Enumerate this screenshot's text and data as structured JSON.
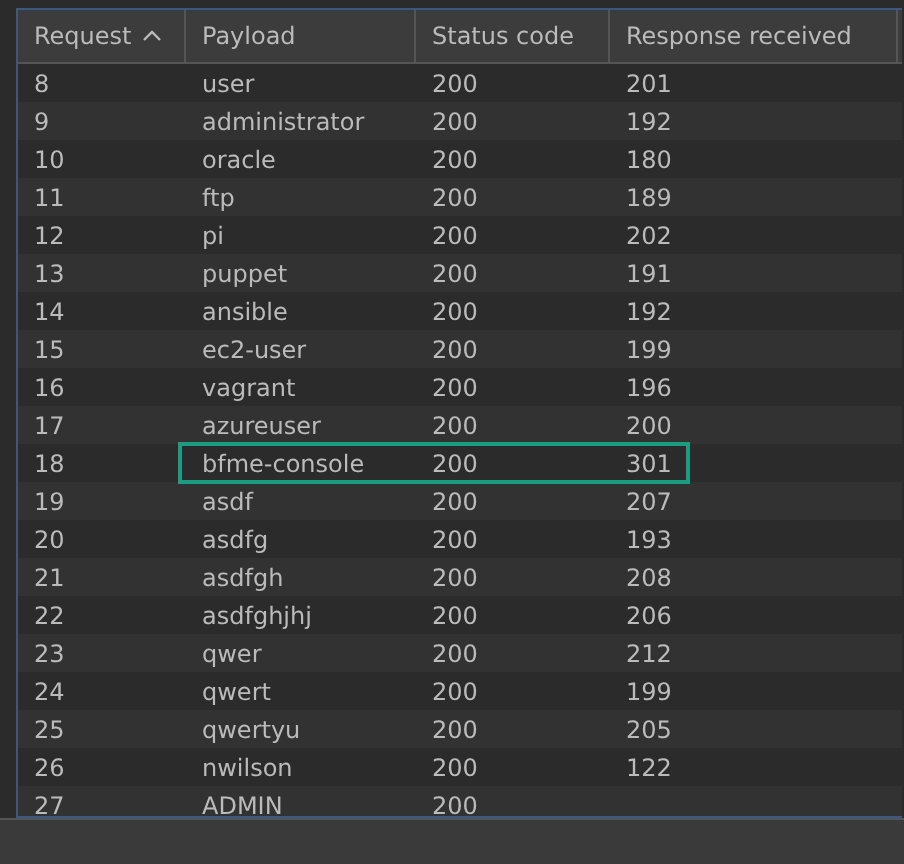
{
  "table": {
    "columns": [
      {
        "label": "Request",
        "sorted": true
      },
      {
        "label": "Payload"
      },
      {
        "label": "Status code"
      },
      {
        "label": "Response received"
      }
    ],
    "rows": [
      {
        "cells": [
          "8",
          "user",
          "200",
          "201"
        ],
        "highlighted": false
      },
      {
        "cells": [
          "9",
          "administrator",
          "200",
          "192"
        ],
        "highlighted": false
      },
      {
        "cells": [
          "10",
          "oracle",
          "200",
          "180"
        ],
        "highlighted": false
      },
      {
        "cells": [
          "11",
          "ftp",
          "200",
          "189"
        ],
        "highlighted": false
      },
      {
        "cells": [
          "12",
          "pi",
          "200",
          "202"
        ],
        "highlighted": false
      },
      {
        "cells": [
          "13",
          "puppet",
          "200",
          "191"
        ],
        "highlighted": false
      },
      {
        "cells": [
          "14",
          "ansible",
          "200",
          "192"
        ],
        "highlighted": false
      },
      {
        "cells": [
          "15",
          "ec2-user",
          "200",
          "199"
        ],
        "highlighted": false
      },
      {
        "cells": [
          "16",
          "vagrant",
          "200",
          "196"
        ],
        "highlighted": false
      },
      {
        "cells": [
          "17",
          "azureuser",
          "200",
          "200"
        ],
        "highlighted": false
      },
      {
        "cells": [
          "18",
          "bfme-console",
          "200",
          "301"
        ],
        "highlighted": true
      },
      {
        "cells": [
          "19",
          "asdf",
          "200",
          "207"
        ],
        "highlighted": false
      },
      {
        "cells": [
          "20",
          "asdfg",
          "200",
          "193"
        ],
        "highlighted": false
      },
      {
        "cells": [
          "21",
          "asdfgh",
          "200",
          "208"
        ],
        "highlighted": false
      },
      {
        "cells": [
          "22",
          "asdfghjhj",
          "200",
          "206"
        ],
        "highlighted": false
      },
      {
        "cells": [
          "23",
          "qwer",
          "200",
          "212"
        ],
        "highlighted": false
      },
      {
        "cells": [
          "24",
          "qwert",
          "200",
          "199"
        ],
        "highlighted": false
      },
      {
        "cells": [
          "25",
          "qwertyu",
          "200",
          "205"
        ],
        "highlighted": false
      },
      {
        "cells": [
          "26",
          "nwilson",
          "200",
          "122"
        ],
        "highlighted": false
      },
      {
        "cells": [
          "27",
          "ADMIN",
          "200"
        ],
        "highlighted": false
      }
    ]
  }
}
